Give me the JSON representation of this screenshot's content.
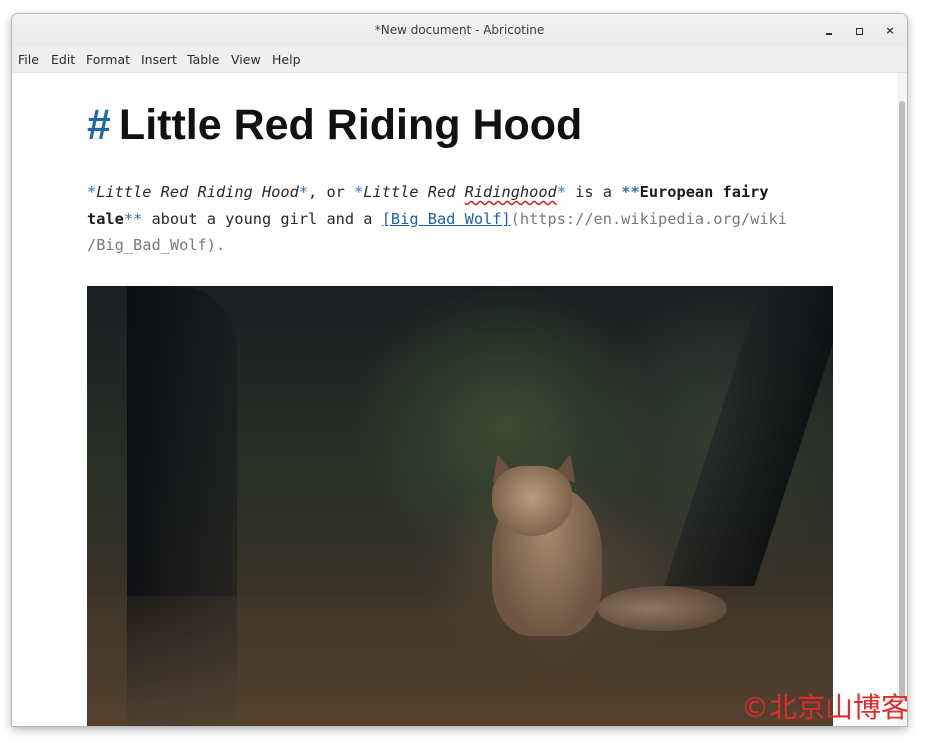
{
  "window": {
    "title": "*New document - Abricotine",
    "minimize_glyph": "‗",
    "maximize_glyph": "▫",
    "close_glyph": "×"
  },
  "menu": {
    "items": [
      "File",
      "Edit",
      "Format",
      "Insert",
      "Table",
      "View",
      "Help"
    ]
  },
  "document": {
    "heading": {
      "marker": "#",
      "text": "Little Red Riding Hood"
    },
    "paragraph": {
      "em1_open": "*",
      "em1_text": "Little Red Riding Hood",
      "em1_close": "*",
      "sep1": ", or ",
      "em2_open": "*",
      "em2_text_a": "Little Red ",
      "em2_text_b": "Ridinghood",
      "em2_close": "*",
      "sep2": " is a ",
      "strong_open": "**",
      "strong_text_a": "European fairy",
      "strong_text_b": "tale",
      "strong_close": "**",
      "sep3": " about a young girl and a ",
      "link_text": "[Big Bad Wolf]",
      "link_url_a": "(https://en.wikipedia.org/wiki",
      "link_url_b": "/Big_Bad_Wolf)",
      "end": "."
    },
    "image": {
      "description_icon": "fox-in-forest-photo"
    }
  },
  "watermark": {
    "text": "©北京山博客"
  },
  "colors": {
    "markdown_marker": "#3a6fb4",
    "heading_marker": "#1f6aa5",
    "link": "#1f5fae",
    "watermark": "#e12b2b"
  }
}
